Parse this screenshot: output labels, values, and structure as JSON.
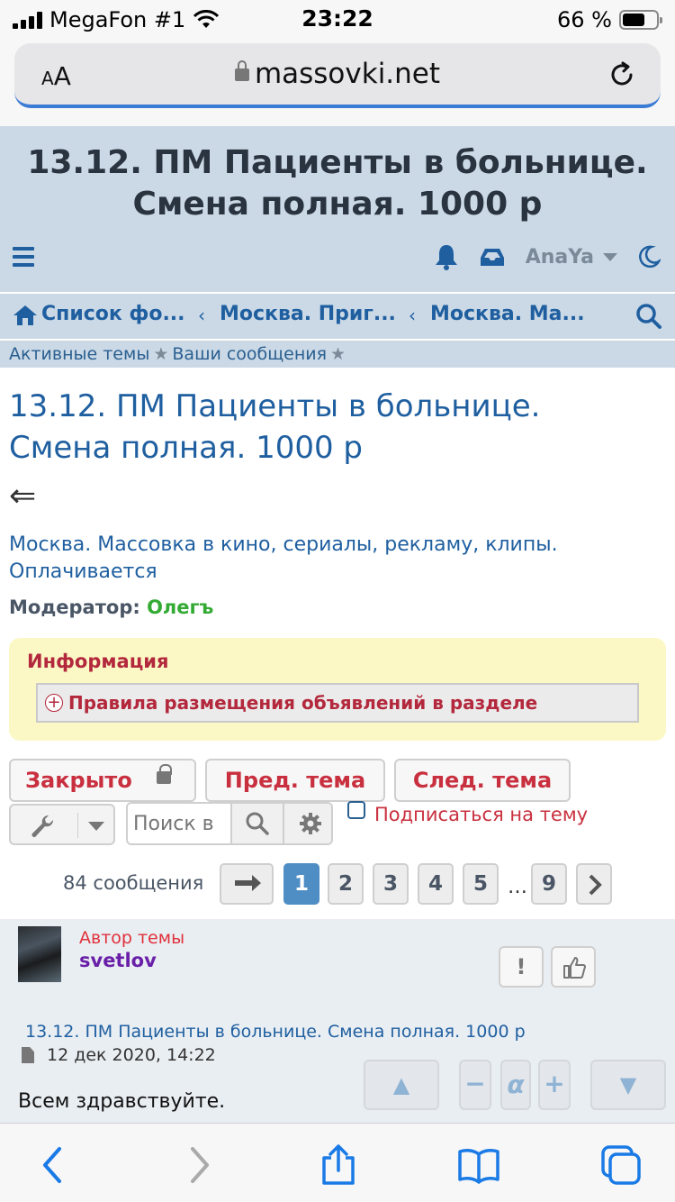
{
  "status_bar": {
    "carrier": "MegaFon #1",
    "time": "23:22",
    "battery_percent": "66 %",
    "battery_level": 0.66
  },
  "browser": {
    "text_size_label": "AA",
    "url": "massovki.net"
  },
  "header": {
    "site_title": "13.12. ПМ Пациенты в больнице. Смена полная. 1000 р",
    "username": "AnaYa"
  },
  "breadcrumbs": [
    {
      "label": "Список фо..."
    },
    {
      "label": "Москва. Приг..."
    },
    {
      "label": "Москва. Ма..."
    }
  ],
  "quick_links": {
    "active_topics": "Активные темы",
    "your_posts": "Ваши сообщения",
    "separator": "★"
  },
  "topic": {
    "title": "13.12. ПМ Пациенты в больнице. Смена полная. 1000 р",
    "back_arrow": "⇐",
    "forum_description": "Москва. Массовка в кино, сериалы, рекламу, клипы. Оплачивается",
    "moderator_label": "Модератор:",
    "moderator_name": "Олегъ"
  },
  "info_box": {
    "title": "Информация",
    "plus": "+",
    "rules_label": "Правила размещения объявлений в разделе"
  },
  "actions": {
    "closed_label": "Закрыто",
    "prev_topic": "Пред. тема",
    "next_topic": "След. тема",
    "search_placeholder": "Поиск в",
    "subscribe_label": "Подписаться на тему"
  },
  "pagination": {
    "posts_count": "84 сообщения",
    "pages": [
      "1",
      "2",
      "3",
      "4",
      "5"
    ],
    "ellipsis": "…",
    "last_page": "9",
    "current_page": "1"
  },
  "post": {
    "author_label": "Автор темы",
    "author_name": "svetlov",
    "report_label": "!",
    "title": "13.12. ПМ Пациенты в больнице. Смена полная. 1000 р",
    "date": "12 дек 2020, 14:22",
    "body": "Всем здравствуйте.",
    "scroll_up": "▲",
    "font_minus": "−",
    "font_alpha": "α",
    "font_plus": "+",
    "scroll_down": "▼"
  },
  "colors": {
    "header_bg": "#cbd9e6",
    "link_blue": "#1f5fa0",
    "accent_red": "#c9303f",
    "info_bg": "#fbf8c6",
    "page_active": "#4f8ec4",
    "moderator_green": "#33aa33",
    "author_purple": "#6a1fa8"
  },
  "icons": {
    "header": [
      "hamburger-icon",
      "bell-icon",
      "inbox-icon",
      "moon-icon",
      "home-icon",
      "search-icon"
    ],
    "toolbar": [
      "back-icon",
      "forward-icon",
      "share-icon",
      "bookmarks-icon",
      "tabs-icon"
    ]
  }
}
